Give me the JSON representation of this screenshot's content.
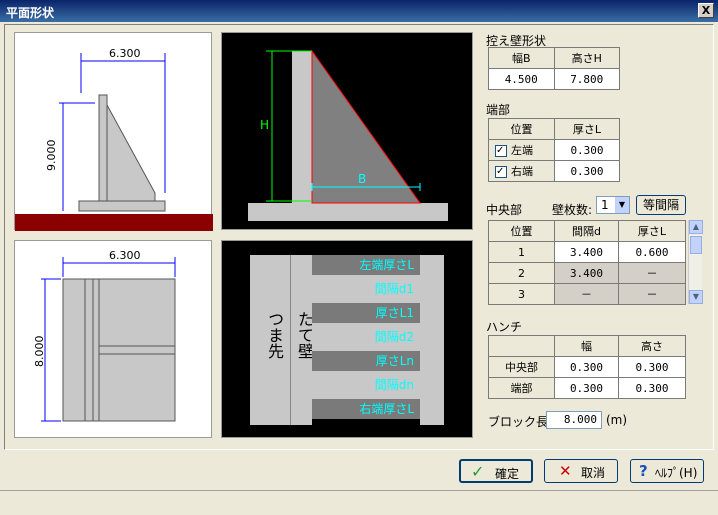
{
  "window": {
    "title": "平面形状",
    "close_glyph": "X"
  },
  "side_view": {
    "width_dim": "6.300",
    "height_dim": "9.000"
  },
  "plan_view": {
    "width_dim": "6.300",
    "height_dim": "8.000"
  },
  "section_view": {
    "h_label": "H",
    "b_label": "B"
  },
  "layout_view": {
    "left_text": "つま先",
    "wall_text": "たて壁",
    "row_labels": [
      "左端厚さL",
      "間隔d1",
      "厚さL1",
      "間隔d2",
      "厚さLn",
      "間隔dn",
      "右端厚さL"
    ]
  },
  "buttress_shape": {
    "title": "控え壁形状",
    "headers": [
      "幅B",
      "高さH"
    ],
    "values": [
      "4.500",
      "7.800"
    ]
  },
  "ends": {
    "title": "端部",
    "headers": [
      "位置",
      "厚さL"
    ],
    "rows": [
      {
        "check": "✓",
        "label": "左端",
        "value": "0.300"
      },
      {
        "check": "✓",
        "label": "右端",
        "value": "0.300"
      }
    ]
  },
  "center": {
    "title": "中央部",
    "count_label": "壁枚数:",
    "count_value": "1",
    "equal_button": "等間隔",
    "headers": [
      "位置",
      "間隔d",
      "厚さL"
    ],
    "rows": [
      {
        "pos": "1",
        "d": "3.400",
        "l": "0.600"
      },
      {
        "pos": "2",
        "d": "3.400",
        "l": "－"
      },
      {
        "pos": "3",
        "d": "－",
        "l": "－"
      }
    ]
  },
  "haunch": {
    "title": "ハンチ",
    "headers": [
      "",
      "幅",
      "高さ"
    ],
    "rows": [
      {
        "label": "中央部",
        "w": "0.300",
        "h": "0.300"
      },
      {
        "label": "端部",
        "w": "0.300",
        "h": "0.300"
      }
    ]
  },
  "block": {
    "label": "ブロック長:",
    "value": "8.000",
    "unit": "(m)"
  },
  "buttons": {
    "ok": "確定",
    "cancel": "取消",
    "help": "ﾍﾙﾌﾟ(H)"
  }
}
